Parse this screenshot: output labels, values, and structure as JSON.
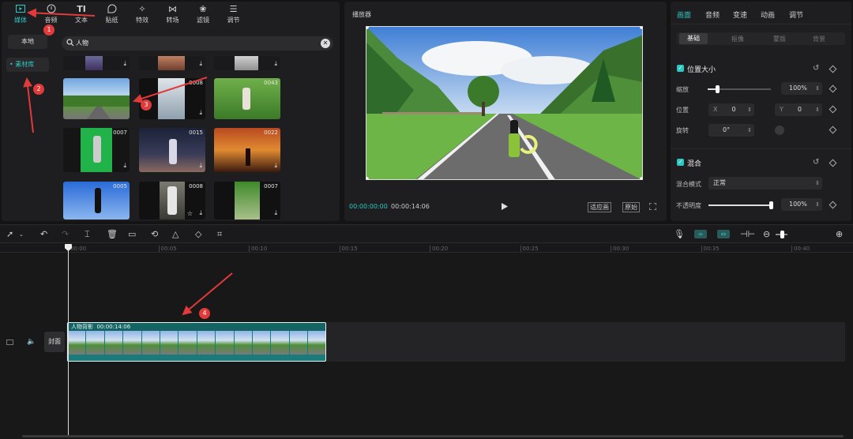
{
  "top_tabs": [
    {
      "label": "媒体",
      "icon": "media-icon",
      "active": true
    },
    {
      "label": "音频",
      "icon": "audio-icon"
    },
    {
      "label": "文本",
      "icon": "text-icon"
    },
    {
      "label": "贴纸",
      "icon": "sticker-icon"
    },
    {
      "label": "特效",
      "icon": "effects-icon"
    },
    {
      "label": "转场",
      "icon": "transition-icon"
    },
    {
      "label": "滤镜",
      "icon": "filter-icon"
    },
    {
      "label": "调节",
      "icon": "adjust-icon"
    }
  ],
  "left_nav": {
    "local": "本地",
    "library": "素材库"
  },
  "search": {
    "value": "人物"
  },
  "thumbnails": {
    "d1": "0008",
    "d2": "0043",
    "d3": "0007",
    "d4": "0015",
    "d5": "0022",
    "d6": "0005",
    "d7": "0008",
    "d8": "0007"
  },
  "player": {
    "title": "播放器",
    "current_time": "00:00:00:00",
    "total_time": "00:00:14:06",
    "btn_fit": "适应画",
    "btn_original": "原始"
  },
  "right_tabs": [
    "画面",
    "音频",
    "变速",
    "动画",
    "调节"
  ],
  "sub_tabs": [
    "基础",
    "抠像",
    "蒙版",
    "背景"
  ],
  "properties": {
    "pos_size_title": "位置大小",
    "scale_label": "缩放",
    "scale_value": "100%",
    "position_label": "位置",
    "x_label": "X",
    "x_value": "0",
    "y_label": "Y",
    "y_value": "0",
    "rotate_label": "旋转",
    "rotate_value": "0°",
    "blend_title": "混合",
    "blend_mode_label": "混合模式",
    "blend_mode_value": "正常",
    "opacity_label": "不透明度",
    "opacity_value": "100%",
    "scale_fraction": 0.15,
    "opacity_fraction": 1.0
  },
  "timeline": {
    "ticks": [
      "00:00",
      "00:05",
      "00:10",
      "00:15",
      "00:20",
      "00:25",
      "00:30",
      "00:35",
      "00:40"
    ],
    "clip_label": "人物背影",
    "clip_duration": "00:00:14:06",
    "cover_label": "封面"
  },
  "annotations": [
    "1",
    "2",
    "3",
    "4"
  ],
  "colors": {
    "accent": "#2dc8c4",
    "annotation": "#e03a3a",
    "clip": "#1b7a7a"
  }
}
